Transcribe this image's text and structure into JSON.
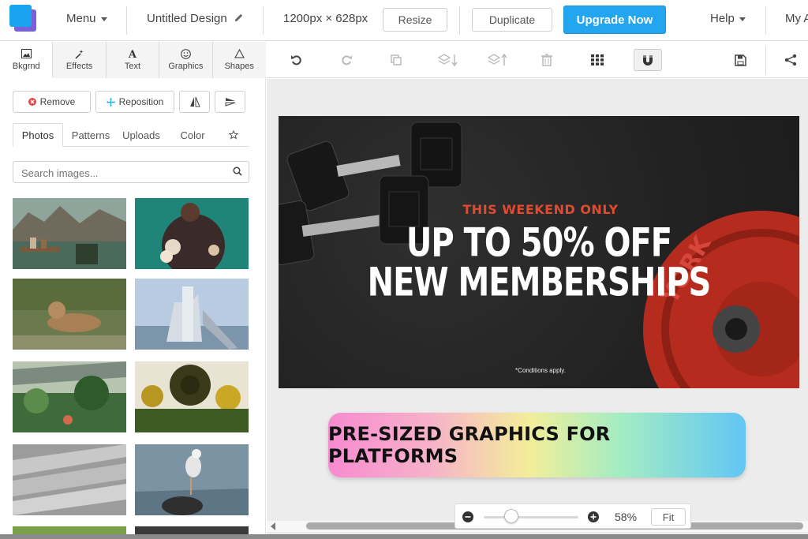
{
  "topbar": {
    "menu_label": "Menu",
    "design_title": "Untitled Design",
    "dimensions": "1200px × 628px",
    "resize_label": "Resize",
    "duplicate_label": "Duplicate",
    "upgrade_label": "Upgrade Now",
    "help_label": "Help",
    "account_label": "My A",
    "accent_color": "#23a6f0"
  },
  "left_tabs": [
    {
      "label": "Bkgrnd",
      "icon": "image-icon"
    },
    {
      "label": "Effects",
      "icon": "magic-wand-icon"
    },
    {
      "label": "Text",
      "icon": "text-icon"
    },
    {
      "label": "Graphics",
      "icon": "smiley-icon"
    },
    {
      "label": "Shapes",
      "icon": "triangle-icon"
    }
  ],
  "tools": {
    "remove_label": "Remove",
    "reposition_label": "Reposition"
  },
  "subtabs": [
    "Photos",
    "Patterns",
    "Uploads",
    "Color"
  ],
  "search": {
    "placeholder": "Search images..."
  },
  "thumbnails": [
    "mountain-lake-deck",
    "woman-flowers-teal",
    "lion-cub-grass",
    "lighthouse-building",
    "greenhouse-plants",
    "sunflowers",
    "paper-folds",
    "seagull-rocks"
  ],
  "ad": {
    "kicker": "THIS WEEKEND ONLY",
    "line1": "UP TO 50% OFF",
    "line2": "NEW MEMBERSHIPS",
    "fine_print": "*Conditions apply.",
    "kicker_color": "#e04a2f",
    "background_color": "#272727",
    "plate_text": "YORK"
  },
  "banner": {
    "text": "PRE-SIZED GRAPHICS FOR PLATFORMS"
  },
  "zoom": {
    "value": "58%",
    "fit_label": "Fit",
    "level": 0.58
  }
}
